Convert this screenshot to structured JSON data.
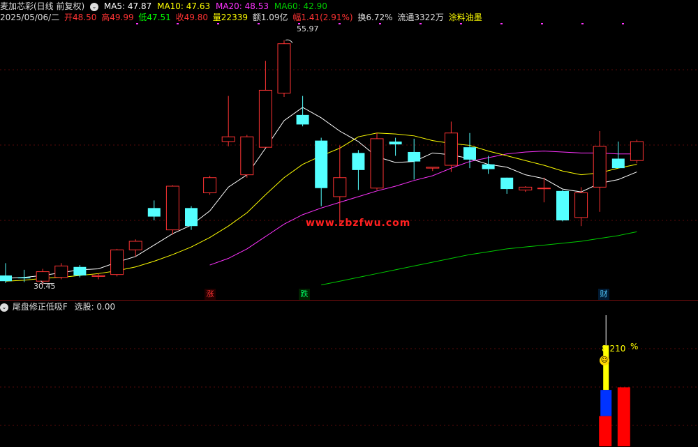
{
  "header": {
    "stock_name": "麦加芯彩(日线 前复权)",
    "ma5": "MA5: 47.87",
    "ma10": "MA10: 47.63",
    "ma20": "MA20: 48.53",
    "ma60": "MA60: 42.90",
    "date": "2025/05/06/二",
    "open": "开48.50",
    "high": "高49.99",
    "low": "低47.51",
    "close": "收49.80",
    "volume": "量22339",
    "amount": "额1.09亿",
    "change": "幅1.41(2.91%)",
    "turnover": "换6.72%",
    "float": "流通3322万",
    "sector": "涂料油墨"
  },
  "chart_labels": {
    "peak": "55.97",
    "trough": "30.45",
    "watermark": "www.zbzfwu.com",
    "event_rise": "涨",
    "event_fall": "跌",
    "event_fin": "财"
  },
  "indicator": {
    "title": "尾盘修正低吸F",
    "selected": "选股: 0.00",
    "value_label": "8.210",
    "percent_sign": "%"
  },
  "colors": {
    "up": "#ff3333",
    "down": "#54ffff",
    "ma5": "#ffffff",
    "ma10": "#ffff00",
    "ma20": "#ff33ff",
    "ma60": "#00cc00"
  },
  "chart_data": {
    "type": "candlestick",
    "ylim": [
      29,
      58
    ],
    "candles": [
      {
        "o": 31.2,
        "h": 32.5,
        "l": 30.4,
        "c": 30.6
      },
      {
        "o": 31.0,
        "h": 31.8,
        "l": 30.5,
        "c": 30.9
      },
      {
        "o": 30.6,
        "h": 31.9,
        "l": 30.2,
        "c": 31.6
      },
      {
        "o": 31.0,
        "h": 32.5,
        "l": 30.8,
        "c": 32.2
      },
      {
        "o": 32.1,
        "h": 32.3,
        "l": 31.0,
        "c": 31.2
      },
      {
        "o": 31.1,
        "h": 31.4,
        "l": 30.8,
        "c": 31.2
      },
      {
        "o": 31.3,
        "h": 34.0,
        "l": 31.1,
        "c": 33.9
      },
      {
        "o": 33.9,
        "h": 35.0,
        "l": 33.2,
        "c": 34.8
      },
      {
        "o": 38.3,
        "h": 39.1,
        "l": 37.0,
        "c": 37.4
      },
      {
        "o": 36.0,
        "h": 40.7,
        "l": 35.5,
        "c": 40.6
      },
      {
        "o": 38.3,
        "h": 38.5,
        "l": 36.0,
        "c": 36.4
      },
      {
        "o": 39.9,
        "h": 41.7,
        "l": 39.7,
        "c": 41.5
      },
      {
        "o": 45.3,
        "h": 50.1,
        "l": 44.8,
        "c": 45.8
      },
      {
        "o": 41.8,
        "h": 46.0,
        "l": 41.5,
        "c": 45.8
      },
      {
        "o": 44.7,
        "h": 53.8,
        "l": 44.7,
        "c": 50.7
      },
      {
        "o": 50.4,
        "h": 55.97,
        "l": 50.0,
        "c": 55.6
      },
      {
        "o": 48.1,
        "h": 50.1,
        "l": 46.9,
        "c": 47.1
      },
      {
        "o": 45.4,
        "h": 45.7,
        "l": 38.5,
        "c": 40.4
      },
      {
        "o": 39.5,
        "h": 44.9,
        "l": 36.5,
        "c": 41.5
      },
      {
        "o": 44.1,
        "h": 44.4,
        "l": 40.2,
        "c": 42.3
      },
      {
        "o": 40.4,
        "h": 46.2,
        "l": 40.2,
        "c": 45.6
      },
      {
        "o": 45.3,
        "h": 45.7,
        "l": 43.8,
        "c": 45.0
      },
      {
        "o": 44.2,
        "h": 45.6,
        "l": 41.3,
        "c": 43.2
      },
      {
        "o": 42.5,
        "h": 42.6,
        "l": 42.2,
        "c": 42.6
      },
      {
        "o": 42.8,
        "h": 47.4,
        "l": 42.1,
        "c": 46.2
      },
      {
        "o": 44.7,
        "h": 46.2,
        "l": 42.5,
        "c": 43.4
      },
      {
        "o": 42.9,
        "h": 43.8,
        "l": 41.9,
        "c": 42.4
      },
      {
        "o": 41.5,
        "h": 41.5,
        "l": 39.8,
        "c": 40.3
      },
      {
        "o": 40.2,
        "h": 40.6,
        "l": 40.0,
        "c": 40.5
      },
      {
        "o": 40.4,
        "h": 41.5,
        "l": 38.9,
        "c": 40.4
      },
      {
        "o": 40.1,
        "h": 40.2,
        "l": 36.9,
        "c": 37.0
      },
      {
        "o": 37.3,
        "h": 40.5,
        "l": 36.4,
        "c": 39.9
      },
      {
        "o": 40.5,
        "h": 46.4,
        "l": 37.9,
        "c": 44.8
      },
      {
        "o": 43.5,
        "h": 45.3,
        "l": 42.9,
        "c": 42.5
      },
      {
        "o": 43.3,
        "h": 45.5,
        "l": 43.0,
        "c": 45.3
      }
    ],
    "ma5": [
      30.9,
      31.0,
      31.2,
      31.5,
      31.8,
      31.9,
      32.6,
      33.2,
      34.4,
      35.6,
      36.5,
      38.0,
      40.5,
      41.8,
      44.6,
      47.5,
      48.9,
      47.8,
      46.4,
      45.3,
      43.7,
      43.1,
      43.2,
      44.1,
      43.9,
      43.5,
      42.9,
      42.6,
      41.8,
      41.4,
      40.3,
      40.0,
      40.9,
      41.3,
      42.1
    ],
    "ma10": [
      30.6,
      30.7,
      30.9,
      31.0,
      31.2,
      31.4,
      31.7,
      32.1,
      32.7,
      33.4,
      34.2,
      35.2,
      36.4,
      37.8,
      39.7,
      41.5,
      42.9,
      43.8,
      44.6,
      45.8,
      46.2,
      46.1,
      45.9,
      45.4,
      45.1,
      44.9,
      44.3,
      43.8,
      43.3,
      42.8,
      42.2,
      41.8,
      42.0,
      42.5,
      42.9
    ],
    "ma20": [
      null,
      null,
      null,
      null,
      null,
      null,
      null,
      null,
      null,
      null,
      null,
      32.3,
      33.0,
      34.0,
      35.3,
      36.6,
      37.6,
      38.3,
      38.9,
      39.5,
      40.1,
      40.6,
      41.2,
      41.7,
      42.5,
      43.2,
      43.6,
      44.0,
      44.2,
      44.3,
      44.2,
      44.1,
      44.1,
      44.0,
      44.0
    ],
    "ma60": [
      null,
      null,
      null,
      null,
      null,
      null,
      null,
      null,
      null,
      null,
      null,
      null,
      null,
      null,
      null,
      null,
      null,
      30.2,
      30.6,
      31.0,
      31.4,
      31.8,
      32.2,
      32.6,
      33.0,
      33.4,
      33.7,
      34.0,
      34.2,
      34.4,
      34.6,
      34.8,
      35.1,
      35.4,
      35.8
    ],
    "indicator_bars": [
      {
        "index": 32,
        "red": 0.23,
        "blue": 0.43,
        "yellow": 0.77,
        "stem": 1.0
      },
      {
        "index": 33,
        "red": 0.45
      }
    ]
  }
}
